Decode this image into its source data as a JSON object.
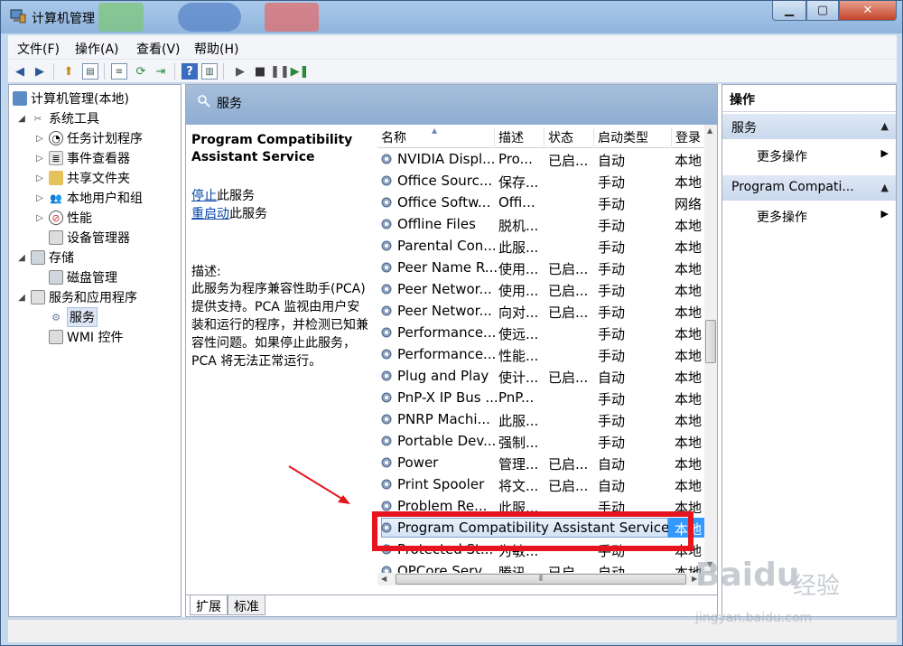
{
  "window": {
    "title": "计算机管理"
  },
  "menu": {
    "file": "文件(F)",
    "action": "操作(A)",
    "view": "查看(V)",
    "help": "帮助(H)"
  },
  "tree": {
    "root": "计算机管理(本地)",
    "system_tools": "系统工具",
    "task_scheduler": "任务计划程序",
    "event_viewer": "事件查看器",
    "shared_folders": "共享文件夹",
    "local_users": "本地用户和组",
    "performance": "性能",
    "device_manager": "设备管理器",
    "storage": "存储",
    "disk_management": "磁盘管理",
    "services_apps": "服务和应用程序",
    "services": "服务",
    "wmi": "WMI 控件"
  },
  "middle": {
    "header": "服务",
    "service_name": "Program Compatibility Assistant Service",
    "stop_link": "停止",
    "stop_suffix": "此服务",
    "restart_link": "重启动",
    "restart_suffix": "此服务",
    "desc_label": "描述:",
    "desc_text": "此服务为程序兼容性助手(PCA)提供支持。PCA 监视由用户安装和运行的程序，并检测已知兼容性问题。如果停止此服务，PCA 将无法正常运行。",
    "tab_extended": "扩展",
    "tab_standard": "标准"
  },
  "columns": {
    "name": "名称",
    "desc": "描述",
    "status": "状态",
    "startup": "启动类型",
    "logon": "登录"
  },
  "services": [
    {
      "name": "NVIDIA Displ...",
      "desc": "Pro...",
      "status": "已启...",
      "startup": "自动",
      "logon": "本地"
    },
    {
      "name": "Office  Sourc...",
      "desc": "保存...",
      "status": "",
      "startup": "手动",
      "logon": "本地"
    },
    {
      "name": "Office Softw...",
      "desc": "Offi...",
      "status": "",
      "startup": "手动",
      "logon": "网络"
    },
    {
      "name": "Offline Files",
      "desc": "脱机...",
      "status": "",
      "startup": "手动",
      "logon": "本地"
    },
    {
      "name": "Parental Con...",
      "desc": "此服...",
      "status": "",
      "startup": "手动",
      "logon": "本地"
    },
    {
      "name": "Peer Name R...",
      "desc": "使用...",
      "status": "已启...",
      "startup": "手动",
      "logon": "本地"
    },
    {
      "name": "Peer Networ...",
      "desc": "使用...",
      "status": "已启...",
      "startup": "手动",
      "logon": "本地"
    },
    {
      "name": "Peer Networ...",
      "desc": "向对...",
      "status": "已启...",
      "startup": "手动",
      "logon": "本地"
    },
    {
      "name": "Performance...",
      "desc": "使远...",
      "status": "",
      "startup": "手动",
      "logon": "本地"
    },
    {
      "name": "Performance...",
      "desc": "性能...",
      "status": "",
      "startup": "手动",
      "logon": "本地"
    },
    {
      "name": "Plug and Play",
      "desc": "使计...",
      "status": "已启...",
      "startup": "自动",
      "logon": "本地"
    },
    {
      "name": "PnP-X IP Bus ...",
      "desc": "PnP...",
      "status": "",
      "startup": "手动",
      "logon": "本地"
    },
    {
      "name": "PNRP Machi...",
      "desc": "此服...",
      "status": "",
      "startup": "手动",
      "logon": "本地"
    },
    {
      "name": "Portable Dev...",
      "desc": "强制...",
      "status": "",
      "startup": "手动",
      "logon": "本地"
    },
    {
      "name": "Power",
      "desc": "管理...",
      "status": "已启...",
      "startup": "自动",
      "logon": "本地"
    },
    {
      "name": "Print Spooler",
      "desc": "将文...",
      "status": "已启...",
      "startup": "自动",
      "logon": "本地"
    },
    {
      "name": "Problem Re...",
      "desc": "此服...",
      "status": "",
      "startup": "手动",
      "logon": "本地"
    }
  ],
  "selected_row": {
    "name": "Program Compatibility Assistant Service",
    "logon": "本地"
  },
  "after_rows": [
    {
      "name": "Protected St...",
      "desc": "为敏...",
      "status": "",
      "startup": "手动",
      "logon": "本地"
    },
    {
      "name": "QPCore Serv...",
      "desc": "腾讯...",
      "status": "已启...",
      "startup": "自动",
      "logon": "本地"
    }
  ],
  "actions": {
    "title": "操作",
    "section1": "服务",
    "more1": "更多操作",
    "section2": "Program Compati...",
    "more2": "更多操作"
  },
  "watermark": {
    "logo": "Baidu",
    "cn": "经验",
    "url": "jingyan.baidu.com"
  },
  "colors": {
    "highlight_red": "#e6141e",
    "selection_blue": "#3399ff",
    "link": "#0645ad"
  }
}
